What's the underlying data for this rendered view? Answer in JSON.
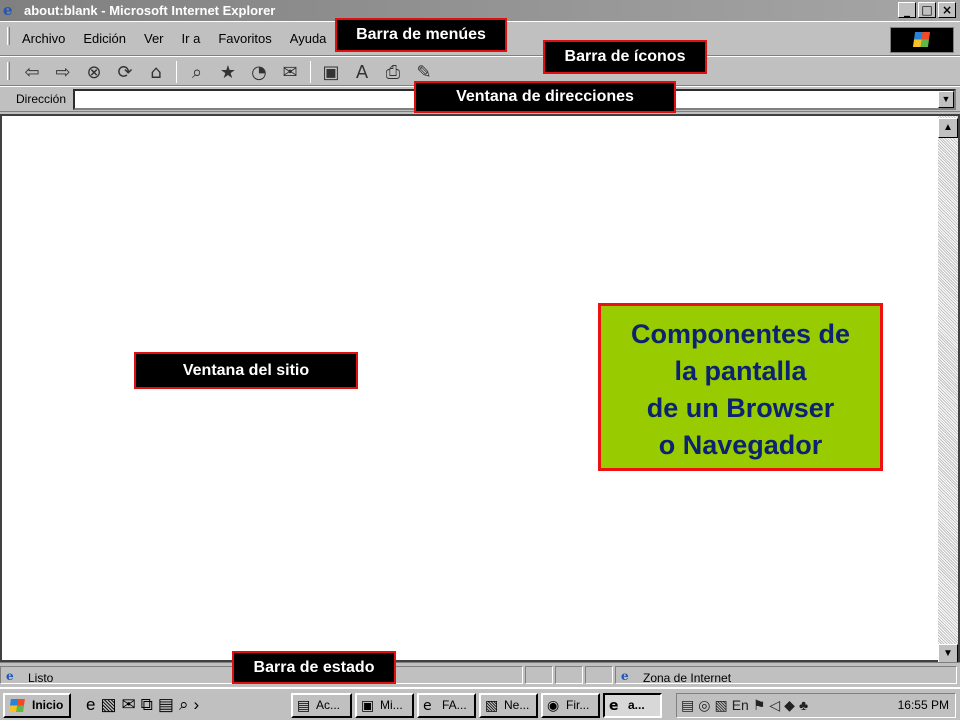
{
  "window": {
    "title": "about:blank - Microsoft Internet Explorer",
    "app_icon": "ie-icon",
    "buttons": [
      "minimize",
      "maximize",
      "close"
    ]
  },
  "menubar": {
    "items": [
      "Archivo",
      "Edición",
      "Ver",
      "Ir a",
      "Favoritos",
      "Ayuda"
    ]
  },
  "toolbar": {
    "icons": [
      "back-arrow-icon",
      "forward-arrow-icon",
      "stop-icon",
      "refresh-icon",
      "home-icon",
      "search-icon",
      "favorites-icon",
      "history-icon",
      "mail-icon",
      "edit-icon",
      "font-icon",
      "print-icon",
      "discussion-icon"
    ]
  },
  "address": {
    "label": "Dirección",
    "value": ""
  },
  "status": {
    "text": "Listo",
    "zone": "Zona de Internet"
  },
  "taskbar": {
    "start": "Inicio",
    "tasks": [
      {
        "label": "Ac...",
        "icon": "folder-icon"
      },
      {
        "label": "Mi...",
        "icon": "computer-icon"
      },
      {
        "label": "FA...",
        "icon": "ie-icon"
      },
      {
        "label": "Ne...",
        "icon": "network-icon"
      },
      {
        "label": "Fir...",
        "icon": "firefox-icon"
      },
      {
        "label": "a...",
        "icon": "ie-icon",
        "active": true
      }
    ],
    "clock": "16:55 PM"
  },
  "annotations": {
    "barra_menus": "Barra de menúes",
    "barra_iconos": "Barra de íconos",
    "ventana_direcciones": "Ventana de direcciones",
    "ventana_sitio": "Ventana del sitio",
    "barra_estado": "Barra de estado"
  },
  "callout": {
    "line1": "Componentes de",
    "line2": "la pantalla",
    "line3": "de un Browser",
    "line4": "o Navegador"
  },
  "colors": {
    "callout_bg": "#99cc00",
    "callout_text": "#0b2370",
    "annotation_border": "#e01010",
    "window_chrome": "#c0c0c0"
  }
}
